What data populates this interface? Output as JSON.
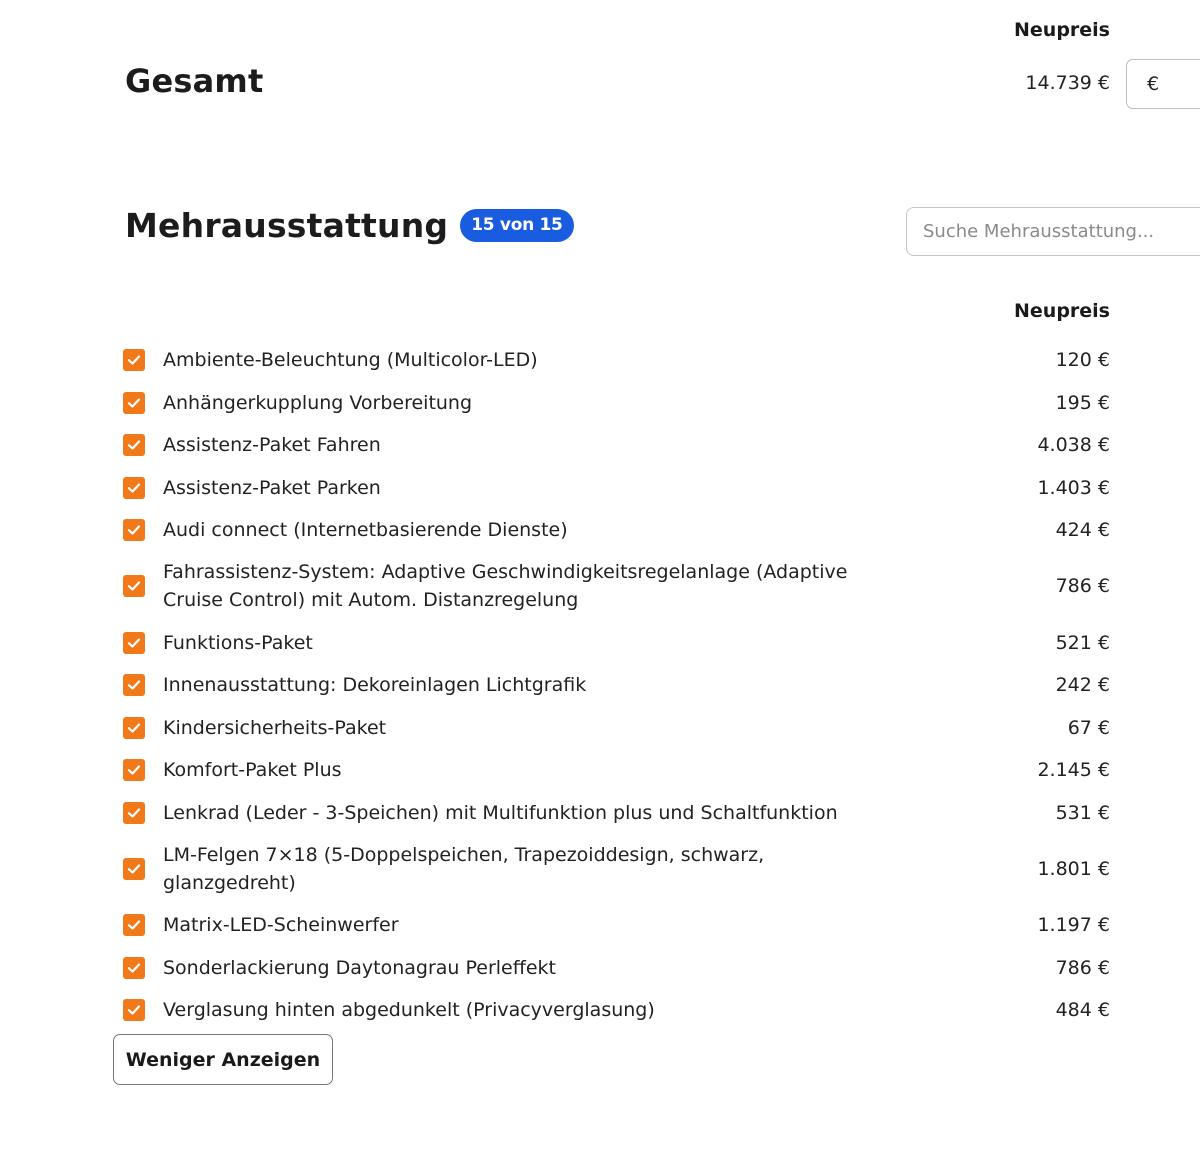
{
  "summary": {
    "title": "Gesamt",
    "price_header": "Neupreis",
    "total_value": "14.739 €",
    "currency_input_value": "€"
  },
  "equipment": {
    "title": "Mehrausstattung",
    "badge": "15 von 15",
    "search_placeholder": "Suche Mehrausstattung...",
    "price_header": "Neupreis",
    "items": [
      {
        "label": "Ambiente-Beleuchtung (Multicolor-LED)",
        "price": "120 €",
        "checked": true
      },
      {
        "label": "Anhängerkupplung Vorbereitung",
        "price": "195 €",
        "checked": true
      },
      {
        "label": "Assistenz-Paket Fahren",
        "price": "4.038 €",
        "checked": true
      },
      {
        "label": "Assistenz-Paket Parken",
        "price": "1.403 €",
        "checked": true
      },
      {
        "label": "Audi connect (Internetbasierende Dienste)",
        "price": "424 €",
        "checked": true
      },
      {
        "label": "Fahrassistenz-System: Adaptive Geschwindigkeitsregelanlage (Adaptive Cruise Control) mit Autom. Distanzregelung",
        "price": "786 €",
        "checked": true
      },
      {
        "label": "Funktions-Paket",
        "price": "521 €",
        "checked": true
      },
      {
        "label": "Innenausstattung: Dekoreinlagen Lichtgrafik",
        "price": "242 €",
        "checked": true
      },
      {
        "label": "Kindersicherheits-Paket",
        "price": "67 €",
        "checked": true
      },
      {
        "label": "Komfort-Paket Plus",
        "price": "2.145 €",
        "checked": true
      },
      {
        "label": "Lenkrad (Leder - 3-Speichen) mit Multifunktion plus und Schaltfunktion",
        "price": "531 €",
        "checked": true
      },
      {
        "label": "LM-Felgen 7×18 (5-Doppelspeichen, Trapezoiddesign, schwarz, glanzgedreht)",
        "price": "1.801 €",
        "checked": true
      },
      {
        "label": "Matrix-LED-Scheinwerfer",
        "price": "1.197 €",
        "checked": true
      },
      {
        "label": "Sonderlackierung Daytonagrau Perleffekt",
        "price": "786 €",
        "checked": true
      },
      {
        "label": "Verglasung hinten abgedunkelt (Privacyverglasung)",
        "price": "484 €",
        "checked": true
      }
    ],
    "show_less_label": "Weniger Anzeigen"
  },
  "colors": {
    "accent_checkbox": "#f07a1a",
    "badge_blue": "#1a5ce0"
  }
}
